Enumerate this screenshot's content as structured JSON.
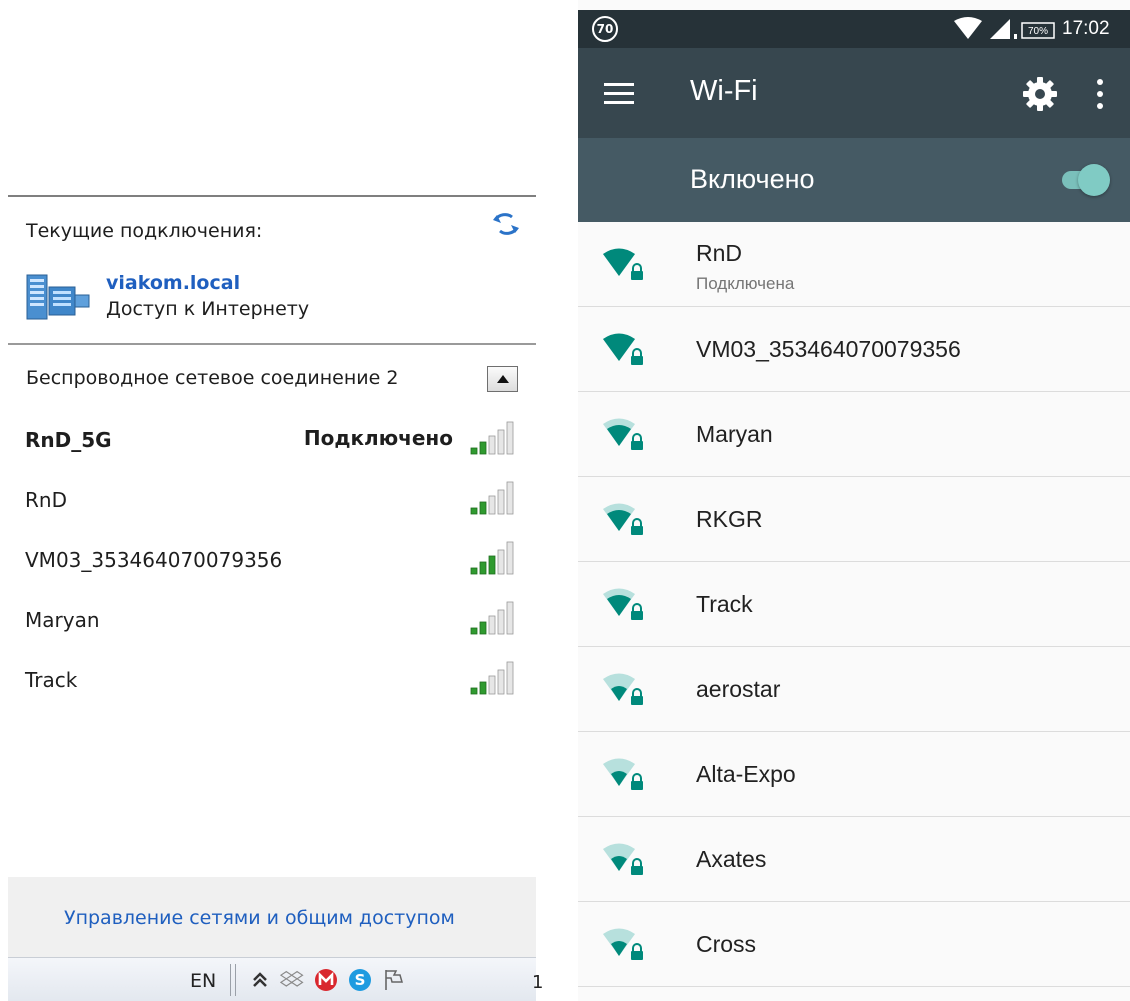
{
  "windows": {
    "current_connections_label": "Текущие подключения:",
    "network": {
      "name": "viakom.local",
      "access": "Доступ к Интернету"
    },
    "wireless_section_title": "Беспроводное сетевое соединение 2",
    "wireless_networks": [
      {
        "ssid": "RnD_5G",
        "status": "Подключено",
        "bold": true,
        "signal_bars": 2
      },
      {
        "ssid": "RnD",
        "status": "",
        "bold": false,
        "signal_bars": 2
      },
      {
        "ssid": "VM03_353464070079356",
        "status": "",
        "bold": false,
        "signal_bars": 3
      },
      {
        "ssid": "Maryan",
        "status": "",
        "bold": false,
        "signal_bars": 2
      },
      {
        "ssid": "Track",
        "status": "",
        "bold": false,
        "signal_bars": 2
      }
    ],
    "footer_link": "Управление сетями и общим доступом",
    "taskbar": {
      "language": "EN",
      "clock_partial": "1"
    }
  },
  "android": {
    "status_bar": {
      "badge": "70",
      "battery": "70%",
      "time": "17:02"
    },
    "toolbar_title": "Wi-Fi",
    "switch_label": "Включено",
    "switch_on": true,
    "networks": [
      {
        "name": "RnD",
        "status": "Подключена",
        "signal": 4
      },
      {
        "name": "VM03_353464070079356",
        "status": "",
        "signal": 4
      },
      {
        "name": "Maryan",
        "status": "",
        "signal": 3
      },
      {
        "name": "RKGR",
        "status": "",
        "signal": 3
      },
      {
        "name": "Track",
        "status": "",
        "signal": 3
      },
      {
        "name": "aerostar",
        "status": "",
        "signal": 2
      },
      {
        "name": "Alta-Expo",
        "status": "",
        "signal": 2
      },
      {
        "name": "Axates",
        "status": "",
        "signal": 2
      },
      {
        "name": "Cross",
        "status": "",
        "signal": 2
      }
    ],
    "accent_color": "#00897b",
    "accent_light_color": "#80cbc4"
  }
}
